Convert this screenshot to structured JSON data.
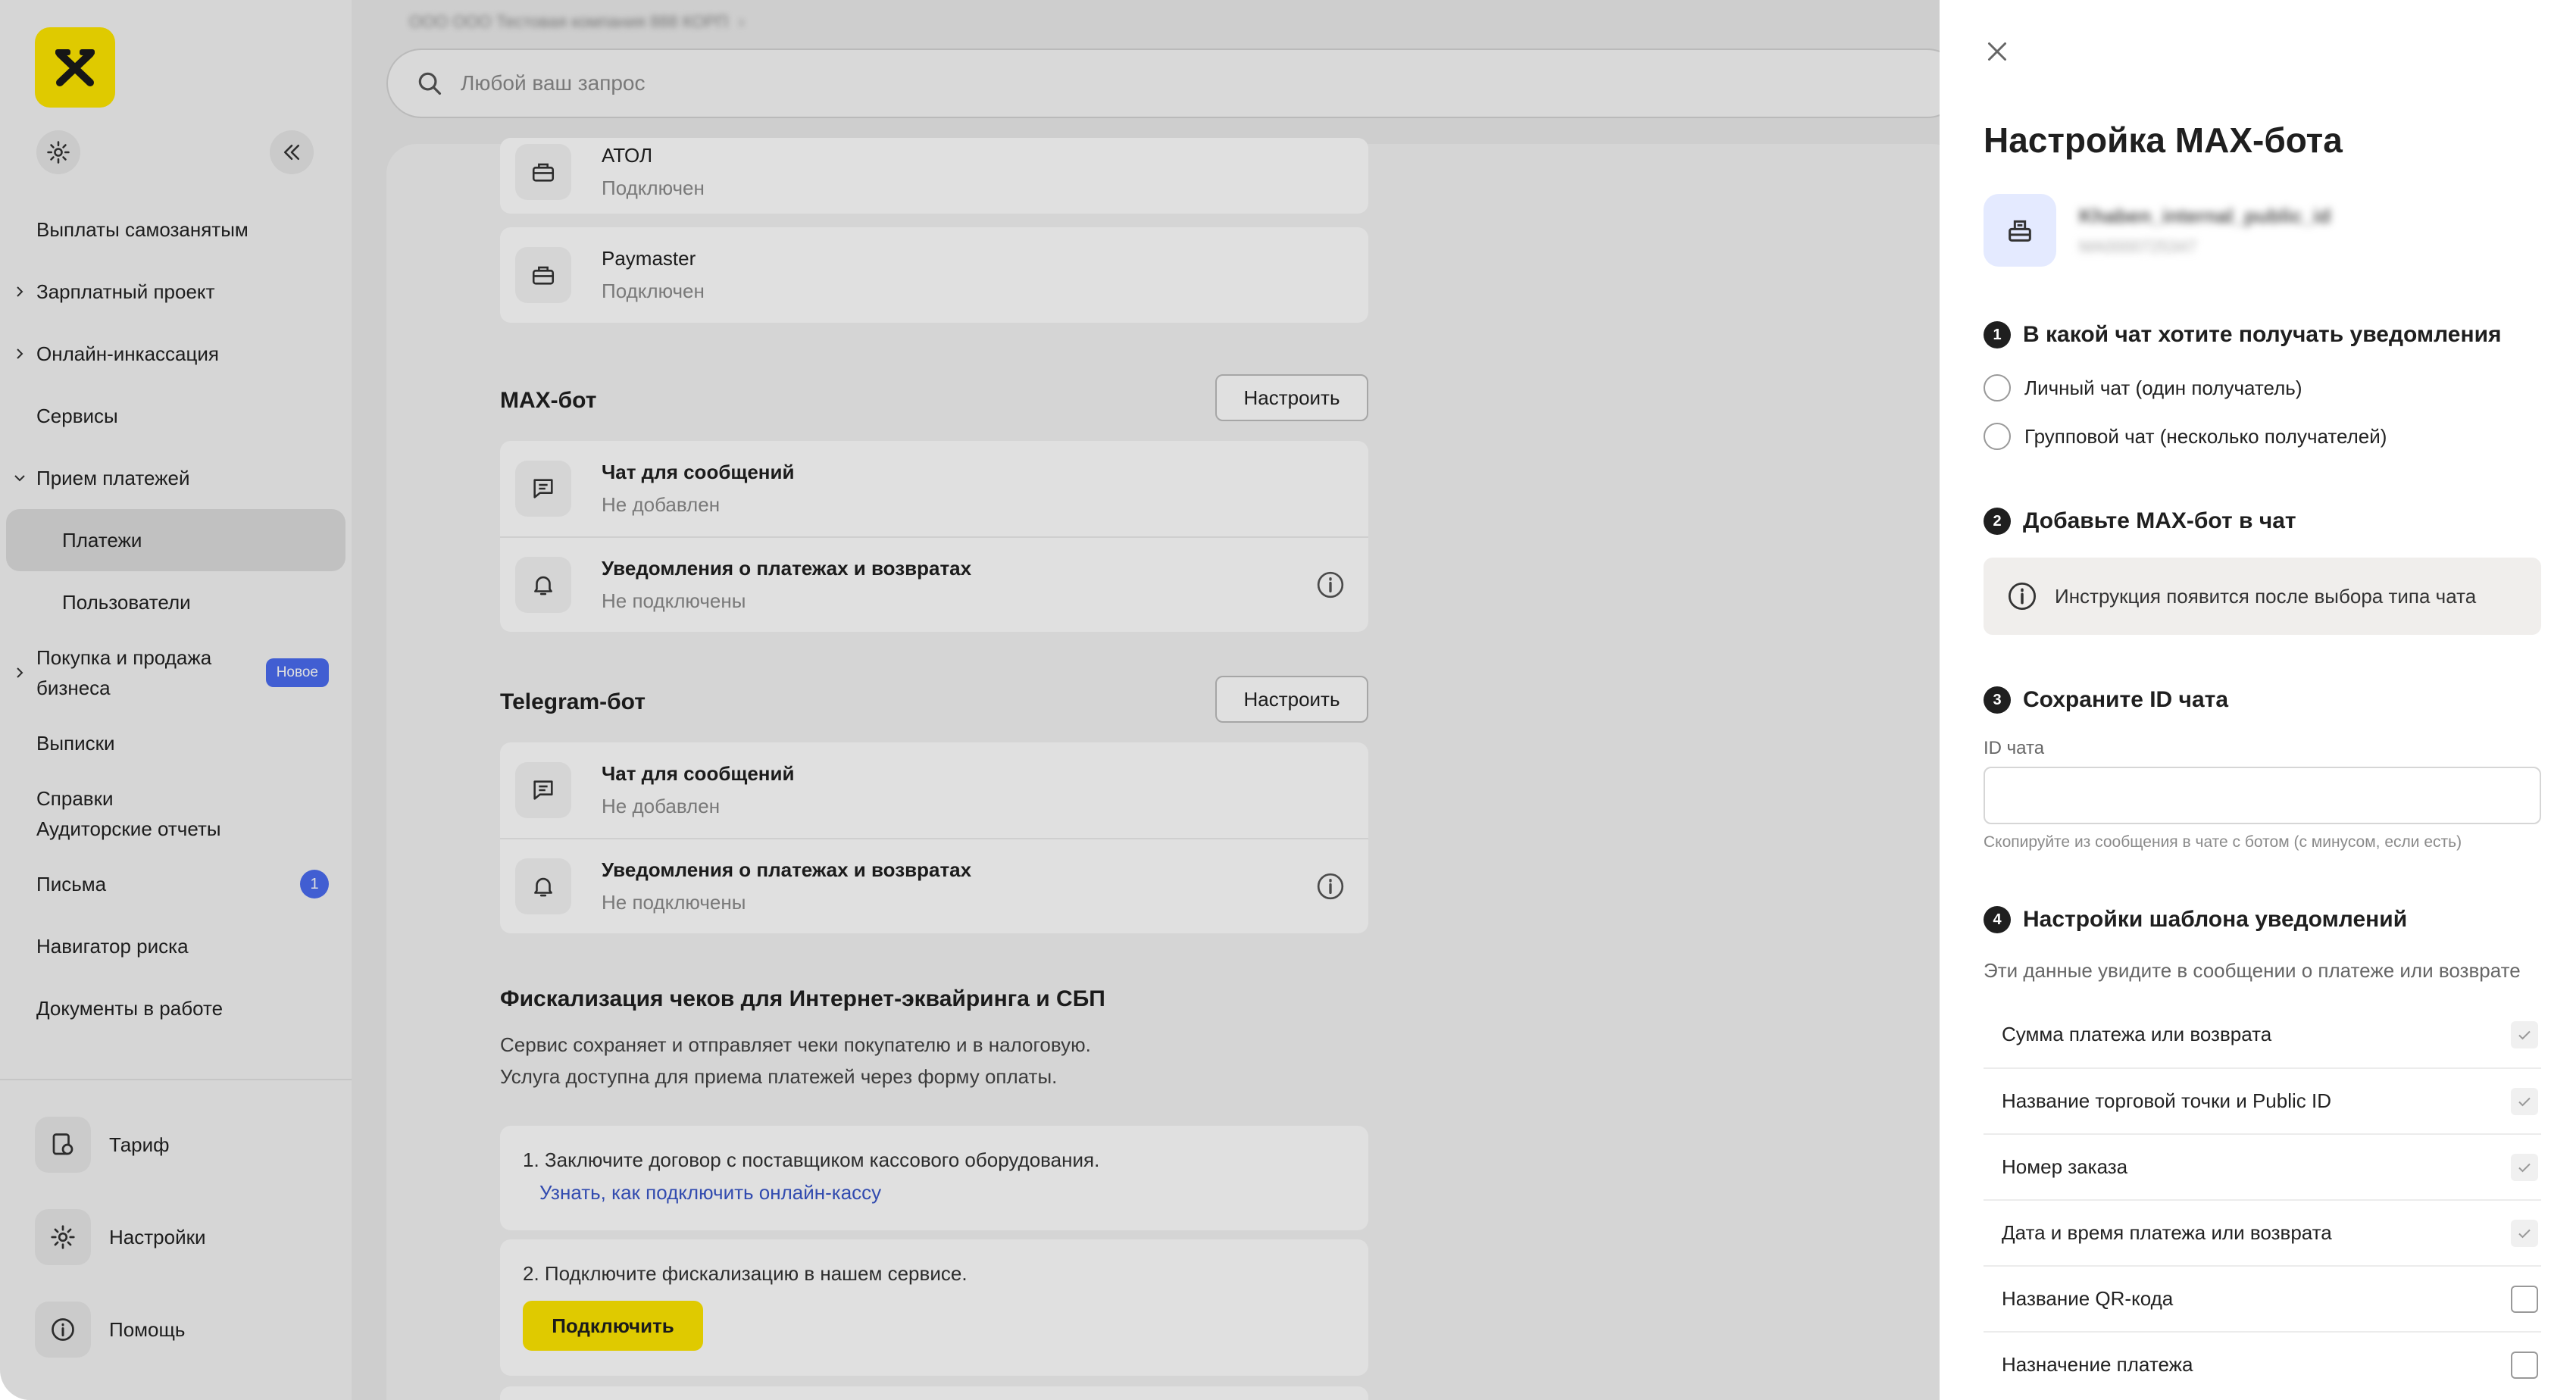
{
  "sidebar": {
    "nav": [
      {
        "label": "Выплаты самозанятым",
        "chevron": "",
        "badge": ""
      },
      {
        "label": "Зарплатный проект",
        "chevron": "right",
        "badge": ""
      },
      {
        "label": "Онлайн-инкассация",
        "chevron": "right",
        "badge": ""
      },
      {
        "label": "Сервисы",
        "chevron": "",
        "badge": ""
      },
      {
        "label": "Прием платежей",
        "chevron": "down",
        "badge": ""
      },
      {
        "label": "Платежи",
        "chevron": "",
        "badge": "",
        "active": true
      },
      {
        "label": "Пользователи",
        "chevron": "",
        "badge": ""
      },
      {
        "label_line1": "Покупка и продажа",
        "label_line2": "бизнеса",
        "chevron": "right",
        "badge": "Новое"
      },
      {
        "label": "Выписки",
        "chevron": "",
        "badge": ""
      },
      {
        "label_line1": "Справки",
        "label_line2": "Аудиторские отчеты",
        "chevron": "",
        "badge": ""
      },
      {
        "label": "Письма",
        "chevron": "",
        "badge": "1"
      },
      {
        "label": "Навигатор риска",
        "chevron": "",
        "badge": ""
      },
      {
        "label": "Документы в работе",
        "chevron": "",
        "badge": ""
      }
    ],
    "bottom": {
      "tariff": "Тариф",
      "settings": "Настройки",
      "help": "Помощь"
    }
  },
  "main": {
    "breadcrumb": "ООО ООО Тестовая компания 888 КОРП",
    "search_placeholder": "Любой ваш запрос",
    "kassas": [
      {
        "name": "АТОЛ",
        "status": "Подключен"
      },
      {
        "name": "Paymaster",
        "status": "Подключен"
      }
    ],
    "max_bot": {
      "title": "MAX-бот",
      "button": "Настроить",
      "rows": [
        {
          "title": "Чат для сообщений",
          "status": "Не добавлен"
        },
        {
          "title": "Уведомления о платежах и возвратах",
          "status": "Не подключены"
        }
      ]
    },
    "telegram_bot": {
      "title": "Telegram-бот",
      "button": "Настроить",
      "rows": [
        {
          "title": "Чат для сообщений",
          "status": "Не добавлен"
        },
        {
          "title": "Уведомления о платежах и возвратах",
          "status": "Не подключены"
        }
      ]
    },
    "fiscal": {
      "title": "Фискализация чеков для Интернет-эквайринга и СБП",
      "text_line1": "Сервис сохраняет и отправляет чеки покупателю и в налоговую.",
      "text_line2": "Услуга доступна для приема платежей через форму оплаты.",
      "step1": "1. Заключите договор с поставщиком кассового оборудования.",
      "step1_link": "Узнать, как подключить онлайн-кассу",
      "step2": "2. Подключите фискализацию в нашем сервисе.",
      "connect_button": "Подключить"
    }
  },
  "panel": {
    "title": "Настройка MAX-бота",
    "shop_name": "Khaben_internal_public_id",
    "shop_id": "MA0000725347",
    "step1": {
      "num": "1",
      "title": "В какой чат хотите получать уведомления",
      "options": [
        "Личный чат (один получатель)",
        "Групповой чат (несколько получателей)"
      ]
    },
    "step2": {
      "num": "2",
      "title": "Добавьте MAX-бот в чат",
      "notice": "Инструкция появится после выбора типа чата"
    },
    "step3": {
      "num": "3",
      "title": "Сохраните ID чата",
      "field_label": "ID чата",
      "field_value": "",
      "hint": "Скопируйте из сообщения в чате с ботом (с минусом, если есть)"
    },
    "step4": {
      "num": "4",
      "title": "Настройки шаблона уведомлений",
      "desc": "Эти данные увидите в сообщении о платеже или возврате",
      "items": [
        {
          "label": "Сумма платежа или возврата",
          "checked": true
        },
        {
          "label": "Название торговой точки и Public ID",
          "checked": true
        },
        {
          "label": "Номер заказа",
          "checked": true
        },
        {
          "label": "Дата и время платежа или возврата",
          "checked": true
        },
        {
          "label": "Название QR-кода",
          "checked": false
        },
        {
          "label": "Назначение платежа",
          "checked": false
        }
      ]
    }
  },
  "colors": {
    "brand_yellow": "#fee600",
    "accent_blue": "#4a6cf0",
    "link_blue": "#3a56c8"
  }
}
